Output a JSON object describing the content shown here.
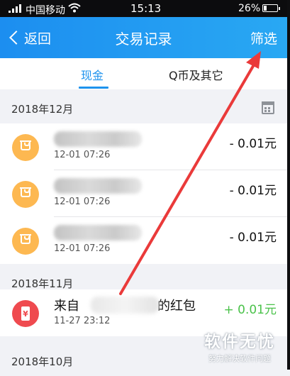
{
  "status_bar": {
    "carrier": "中国移动",
    "wifi_icon": "wifi-icon",
    "time": "15:13",
    "battery": "26%",
    "battery_level": 0.26
  },
  "header": {
    "back_label": "返回",
    "title": "交易记录",
    "filter_label": "筛选"
  },
  "tabs": [
    {
      "label": "现金",
      "active": true
    },
    {
      "label": "Q币及其它",
      "active": false
    }
  ],
  "sections": [
    {
      "title": "2018年12月",
      "rows": [
        {
          "name": "",
          "time": "12-01 07:26",
          "amount": "- 0.01元"
        },
        {
          "name": "",
          "time": "12-01 07:26",
          "amount": "- 0.01元"
        },
        {
          "name": "",
          "time": "12-01 07:26",
          "amount": "- 0.01元"
        }
      ]
    },
    {
      "title": "2018年11月",
      "rows": [
        {
          "name_prefix": "来自",
          "name_suffix": "的红包",
          "time": "11-27 23:12",
          "amount": "+ 0.01元"
        }
      ]
    },
    {
      "title": "2018年10月"
    }
  ],
  "watermark": {
    "title": "软件无忧",
    "subtitle": "努力解决软件问题"
  },
  "colors": {
    "accent": "#1e93ee",
    "header_gradient_start": "#1c8ef0",
    "header_gradient_end": "#29a8f3",
    "positive_amount": "#4ac24a",
    "annotation_arrow": "#ea3a3a"
  }
}
